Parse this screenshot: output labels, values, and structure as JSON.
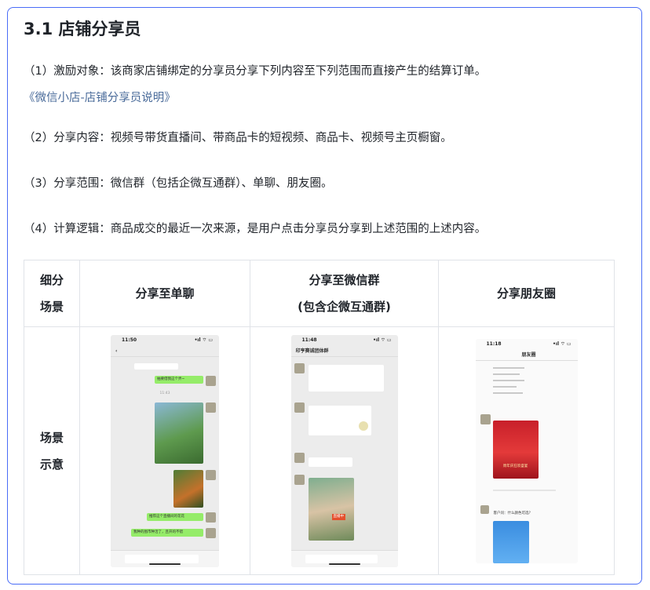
{
  "section_title": "3.1 店铺分享员",
  "paragraphs": {
    "p1_text": "（1）激励对象：该商家店铺绑定的分享员分享下列内容至下列范围而直接产生的结算订单。",
    "p1_link": "《微信小店-店铺分享员说明》",
    "p2": "（2）分享内容：视频号带货直播间、带商品卡的短视频、商品卡、视频号主页橱窗。",
    "p3": "（3）分享范围：微信群（包括企微互通群）、单聊、朋友圈。",
    "p4": "（4）计算逻辑：商品成交的最近一次来源，是用户点击分享员分享到上述范围的上述内容。"
  },
  "table": {
    "header_col0_line1": "细分",
    "header_col0_line2": "场景",
    "header_col1": "分享至单聊",
    "header_col2_line1": "分享至微信群",
    "header_col2_line2": "(包含企微互通群)",
    "header_col3": "分享朋友圈",
    "row_label_line1": "场景",
    "row_label_line2": "示意"
  },
  "phones": {
    "chat": {
      "time": "11:50",
      "status": "•ıl ⌔ ▭",
      "bubble1": "抽要借我这个弄~",
      "timestamp": "11:43",
      "bubble2": "推荐这个直播间的花花",
      "bubble3": "我种的图市种活了，且开的不错"
    },
    "group": {
      "time": "11:48",
      "status": "•ıl ⌔ ▭",
      "title": "印亨赛诚团体群",
      "live_label": "直播中"
    },
    "moments": {
      "time": "11:18",
      "status": "•ıl ⌔ ▭",
      "title": "朋友圈",
      "poster_text": "周年庆狂欢盛宴",
      "comment": "客户问：什么颜色可选？"
    }
  }
}
